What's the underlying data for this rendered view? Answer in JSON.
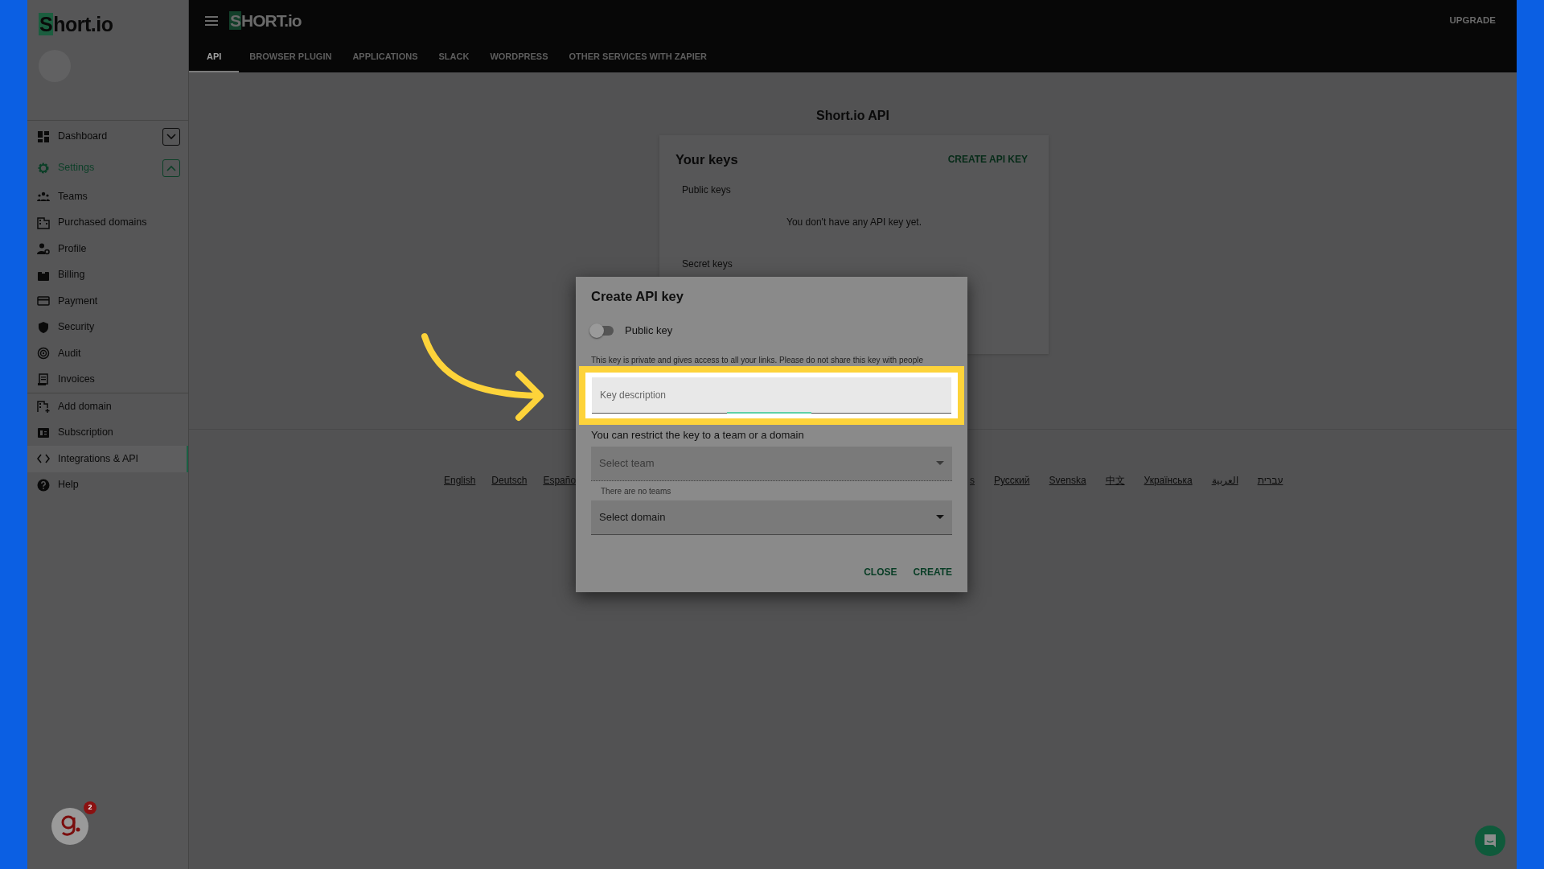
{
  "sidebar": {
    "logo": "Short.io",
    "groups": [
      [
        {
          "label": "Dashboard",
          "kind": "section",
          "expanded": false,
          "selected": false
        },
        {
          "label": "Settings",
          "kind": "section",
          "expanded": true,
          "selected": false
        },
        {
          "label": "Teams",
          "kind": "link",
          "selected": false
        },
        {
          "label": "Purchased domains",
          "kind": "link",
          "selected": false
        },
        {
          "label": "Profile",
          "kind": "link",
          "selected": false
        },
        {
          "label": "Billing",
          "kind": "link",
          "selected": false
        },
        {
          "label": "Payment",
          "kind": "link",
          "selected": false
        },
        {
          "label": "Security",
          "kind": "link",
          "selected": false
        },
        {
          "label": "Audit",
          "kind": "link",
          "selected": false
        },
        {
          "label": "Invoices",
          "kind": "link",
          "selected": false
        }
      ],
      [
        {
          "label": "Add domain",
          "kind": "link",
          "selected": false
        },
        {
          "label": "Subscription",
          "kind": "link",
          "selected": false
        },
        {
          "label": "Integrations & API",
          "kind": "link",
          "selected": true
        },
        {
          "label": "Help",
          "kind": "link",
          "selected": false
        }
      ]
    ],
    "chat_badge": "2"
  },
  "topbar": {
    "logo": "SHORT.io",
    "upgrade": "UPGRADE",
    "tabs": [
      {
        "label": "API",
        "selected": true
      },
      {
        "label": "BROWSER PLUGIN",
        "selected": false
      },
      {
        "label": "APPLICATIONS",
        "selected": false
      },
      {
        "label": "SLACK",
        "selected": false
      },
      {
        "label": "WORDPRESS",
        "selected": false
      },
      {
        "label": "OTHER SERVICES WITH ZAPIER",
        "selected": false
      }
    ]
  },
  "main": {
    "title": "Short.io API",
    "card": {
      "title": "Your keys",
      "action": "CREATE API KEY",
      "public_heading": "Public keys",
      "empty": "You don't have any API key yet.",
      "secret_heading": "Secret keys"
    },
    "languages_left": [
      "English",
      "Deutsch",
      "Españo"
    ],
    "languages_right": [
      "s",
      "Русский",
      "Svenska",
      "中文",
      "Українська",
      "العربية",
      "עברית"
    ]
  },
  "modal": {
    "title": "Create API key",
    "toggle": {
      "label": "Public key",
      "on": false
    },
    "notice": "This key is private and gives access to all your links. Please do not share this key with people",
    "key_field": {
      "placeholder": "Key description",
      "focused": true
    },
    "restrict_label": "You can restrict the key to a team or a domain",
    "team_select": {
      "placeholder": "Select team",
      "disabled": true,
      "hint": "There are no teams"
    },
    "domain_select": {
      "placeholder": "Select domain",
      "disabled": false
    },
    "buttons": [
      "CLOSE",
      "CREATE"
    ]
  }
}
